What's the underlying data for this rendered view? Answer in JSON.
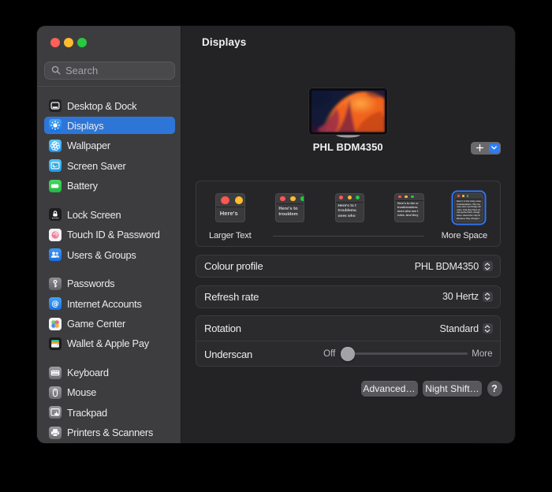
{
  "colors": {
    "accent_blue": "#2d76d7",
    "focus_ring_blue": "#3274f0",
    "add_button_blue": "#2d7cf5",
    "traffic_red": "#ff5f57",
    "traffic_yellow": "#febc2e",
    "traffic_green": "#28c840"
  },
  "sidebar": {
    "search_placeholder": "Search",
    "groups": [
      {
        "items": [
          {
            "label": "Desktop & Dock",
            "icon": "desktop-dock-icon",
            "selected": false
          },
          {
            "label": "Displays",
            "icon": "displays-icon",
            "selected": true
          },
          {
            "label": "Wallpaper",
            "icon": "wallpaper-icon",
            "selected": false
          },
          {
            "label": "Screen Saver",
            "icon": "screen-saver-icon",
            "selected": false
          },
          {
            "label": "Battery",
            "icon": "battery-icon",
            "selected": false
          }
        ]
      },
      {
        "items": [
          {
            "label": "Lock Screen",
            "icon": "lock-screen-icon",
            "selected": false
          },
          {
            "label": "Touch ID & Password",
            "icon": "touch-id-icon",
            "selected": false
          },
          {
            "label": "Users & Groups",
            "icon": "users-groups-icon",
            "selected": false
          }
        ]
      },
      {
        "items": [
          {
            "label": "Passwords",
            "icon": "passwords-icon",
            "selected": false
          },
          {
            "label": "Internet Accounts",
            "icon": "internet-accounts-icon",
            "selected": false
          },
          {
            "label": "Game Center",
            "icon": "game-center-icon",
            "selected": false
          },
          {
            "label": "Wallet & Apple Pay",
            "icon": "wallet-icon",
            "selected": false
          }
        ]
      },
      {
        "items": [
          {
            "label": "Keyboard",
            "icon": "keyboard-icon",
            "selected": false
          },
          {
            "label": "Mouse",
            "icon": "mouse-icon",
            "selected": false
          },
          {
            "label": "Trackpad",
            "icon": "trackpad-icon",
            "selected": false
          },
          {
            "label": "Printers & Scanners",
            "icon": "printers-icon",
            "selected": false
          }
        ]
      }
    ]
  },
  "header": {
    "title": "Displays"
  },
  "display": {
    "name": "PHL BDM4350"
  },
  "add_display": {
    "plus_icon": "plus-icon",
    "chevron_icon": "chevron-down-icon"
  },
  "scale": {
    "left_label": "Larger Text",
    "right_label": "More Space",
    "selected_index": 4,
    "thumbs": [
      {
        "lines": [
          "Here's"
        ]
      },
      {
        "lines": [
          "Here's to",
          "troublem"
        ]
      },
      {
        "lines": [
          "Here's to t",
          "troublema",
          "ones who"
        ]
      },
      {
        "lines": [
          "Here's to the cr",
          "troublemakers.",
          "ones who see t",
          "rules. And they"
        ]
      },
      {
        "lines": [
          "Here's to the crazy ones",
          "troublemakers. The rou",
          "ones who see things dif",
          "rules. And they have no",
          "can quote them, disagr",
          "them. About the only th",
          "Because they change t"
        ]
      }
    ]
  },
  "settings": {
    "colour_profile": {
      "label": "Colour profile",
      "value": "PHL BDM4350"
    },
    "refresh_rate": {
      "label": "Refresh rate",
      "value": "30 Hertz"
    },
    "rotation": {
      "label": "Rotation",
      "value": "Standard"
    },
    "underscan": {
      "label": "Underscan",
      "min_label": "Off",
      "max_label": "More",
      "value": 0
    }
  },
  "buttons": {
    "advanced": "Advanced…",
    "night_shift": "Night Shift…",
    "help": "?"
  }
}
